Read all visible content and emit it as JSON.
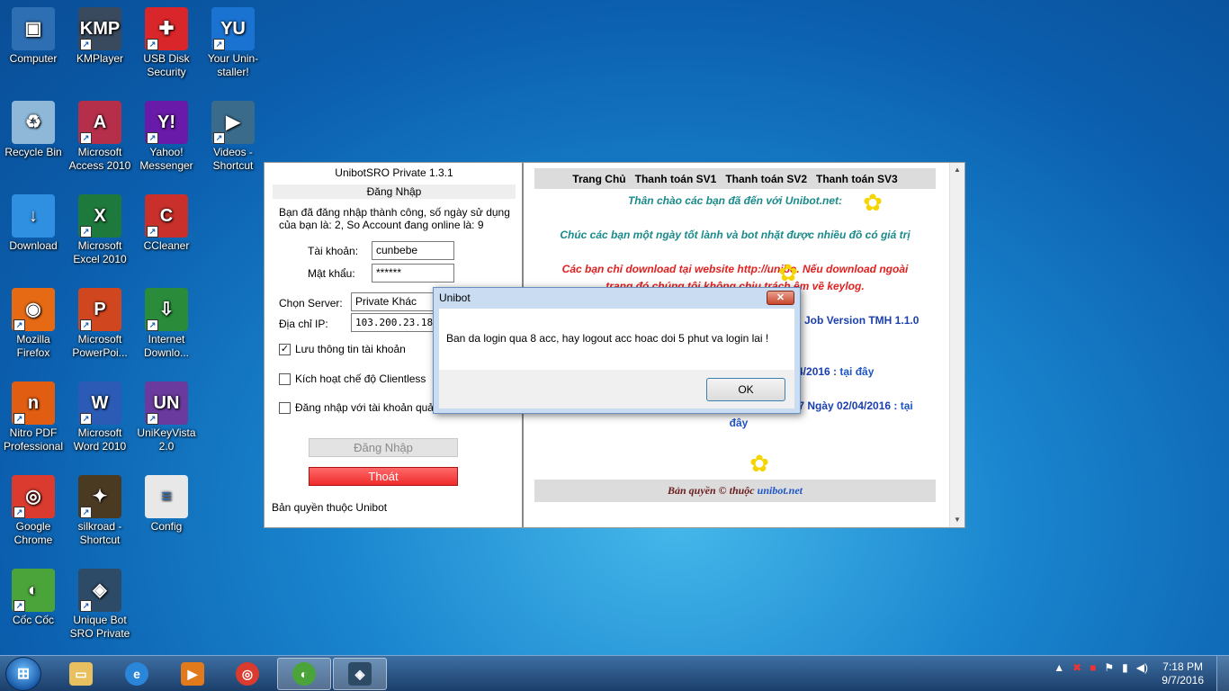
{
  "desktop": {
    "icons": [
      {
        "label": "Computer",
        "icon": "computer-icon",
        "color": "#2e6fb3",
        "glyph": "▣",
        "shortcut": false
      },
      {
        "label": "KMPlayer",
        "icon": "kmplayer-icon",
        "color": "#3a4a5e",
        "glyph": "KMP",
        "shortcut": true
      },
      {
        "label": "USB Disk Security",
        "icon": "shield-icon",
        "color": "#d9262a",
        "glyph": "✚",
        "shortcut": true
      },
      {
        "label": "Your Unin-staller!",
        "icon": "uninstaller-icon",
        "color": "#1b73d1",
        "glyph": "YU",
        "shortcut": true
      },
      {
        "label": "Recycle Bin",
        "icon": "recycle-bin-icon",
        "color": "#8fb8d8",
        "glyph": "♻",
        "shortcut": false
      },
      {
        "label": "Microsoft Access 2010",
        "icon": "access-icon",
        "color": "#b52e4a",
        "glyph": "A",
        "shortcut": true
      },
      {
        "label": "Yahoo! Messenger",
        "icon": "yahoo-icon",
        "color": "#6a1aa8",
        "glyph": "Y!",
        "shortcut": true
      },
      {
        "label": "Videos - Shortcut",
        "icon": "videos-icon",
        "color": "#3b6b8a",
        "glyph": "▶",
        "shortcut": true
      },
      {
        "label": "Download",
        "icon": "download-icon",
        "color": "#2f8fe0",
        "glyph": "↓",
        "shortcut": false
      },
      {
        "label": "Microsoft Excel 2010",
        "icon": "excel-icon",
        "color": "#1e7a3c",
        "glyph": "X",
        "shortcut": true
      },
      {
        "label": "CCleaner",
        "icon": "ccleaner-icon",
        "color": "#c9302c",
        "glyph": "C",
        "shortcut": true
      },
      {
        "label": "Mozilla Firefox",
        "icon": "firefox-icon",
        "color": "#e66a14",
        "glyph": "◉",
        "shortcut": true
      },
      {
        "label": "Microsoft PowerPoi...",
        "icon": "powerpoint-icon",
        "color": "#d0471f",
        "glyph": "P",
        "shortcut": true
      },
      {
        "label": "Internet Downlo...",
        "icon": "idm-icon",
        "color": "#2a8b3a",
        "glyph": "⇩",
        "shortcut": true
      },
      {
        "label": "Nitro PDF Professional",
        "icon": "nitro-pdf-icon",
        "color": "#e05d12",
        "glyph": "n",
        "shortcut": true
      },
      {
        "label": "Microsoft Word 2010",
        "icon": "word-icon",
        "color": "#2b5bb5",
        "glyph": "W",
        "shortcut": true
      },
      {
        "label": "UniKeyVista 2.0",
        "icon": "unikey-icon",
        "color": "#6a3a9e",
        "glyph": "UN",
        "shortcut": true
      },
      {
        "label": "Google Chrome",
        "icon": "chrome-icon",
        "color": "#db3b2f",
        "glyph": "◎",
        "shortcut": true
      },
      {
        "label": "silkroad - Shortcut",
        "icon": "silkroad-icon",
        "color": "#4a3a22",
        "glyph": "✦",
        "shortcut": true
      },
      {
        "label": "Config",
        "icon": "config-file-icon",
        "color": "#e8e8e8",
        "glyph": "≡",
        "shortcut": false
      },
      {
        "label": "Cốc Cốc",
        "icon": "coccoc-icon",
        "color": "#4aa43a",
        "glyph": "◐",
        "shortcut": true
      },
      {
        "label": "Unique Bot SRO Private",
        "icon": "uniquebot-icon",
        "color": "#2d4a66",
        "glyph": "◈",
        "shortcut": true
      }
    ]
  },
  "app": {
    "title": "UnibotSRO Private 1.3.1",
    "section": "Đăng Nhập",
    "message": "Bạn đã đăng nhập thành công, số ngày sử dụng của bạn là: 2, So Account đang online là: 9",
    "username_label": "Tài khoản:",
    "username_value": "cunbebe",
    "password_label": "Mật khẩu:",
    "password_value": "******",
    "server_label": "Chọn Server:",
    "server_value": "Private Khác",
    "ip_label": "Địa chỉ IP:",
    "ip_value": "103.200.23.18",
    "save_info": "Lưu thông tin tài khoản",
    "clientless": "Kích hoạt chế độ Clientless",
    "other_account": "Đăng nhập với tài khoản quả",
    "login_button": "Đăng Nhập",
    "exit_button": "Thoát",
    "footer": "Bản quyền thuộc Unibot"
  },
  "web": {
    "nav": [
      "Trang Chủ",
      "Thanh toán SV1",
      "Thanh toán SV2",
      "Thanh toán SV3"
    ],
    "welcome": "Thân chào các bạn đã đến với Unibot.net:",
    "wish": "Chúc các bạn một ngày tốt lành và bot nhặt được nhiều đồ có giá trị",
    "warning_1": "Các bạn chỉ download tại website http://unibo",
    "warning_1b": ". Nếu download ngoài",
    "warning_2": "trang đó chúng tôi không chịu trách",
    "warning_2b": "ệm về keylog.",
    "version": "Job Version TMH 1.1.0",
    "date1": "/14/2016 : ",
    "link1": "tại đây",
    "date2": ".7 Ngày 02/04/2016 : ",
    "link2": "tại",
    "link2b": "đây",
    "copyright_prefix": "Bản quyền © thuộc ",
    "copyright_link": "unibot.net"
  },
  "dialog": {
    "title": "Unibot",
    "close": "✕",
    "message": "Ban da login qua 8 acc, hay logout acc hoac doi 5 phut va login lai !",
    "ok": "OK"
  },
  "taskbar": {
    "start": "⊞",
    "time": "7:18 PM",
    "date": "9/7/2016",
    "tray_up": "▲",
    "volume": "◀)"
  },
  "colors": {
    "teal_text": "#1a8a8a",
    "red_text": "#e02020",
    "blue_text": "#1a3fb0",
    "link_blue": "#1d56c9"
  }
}
